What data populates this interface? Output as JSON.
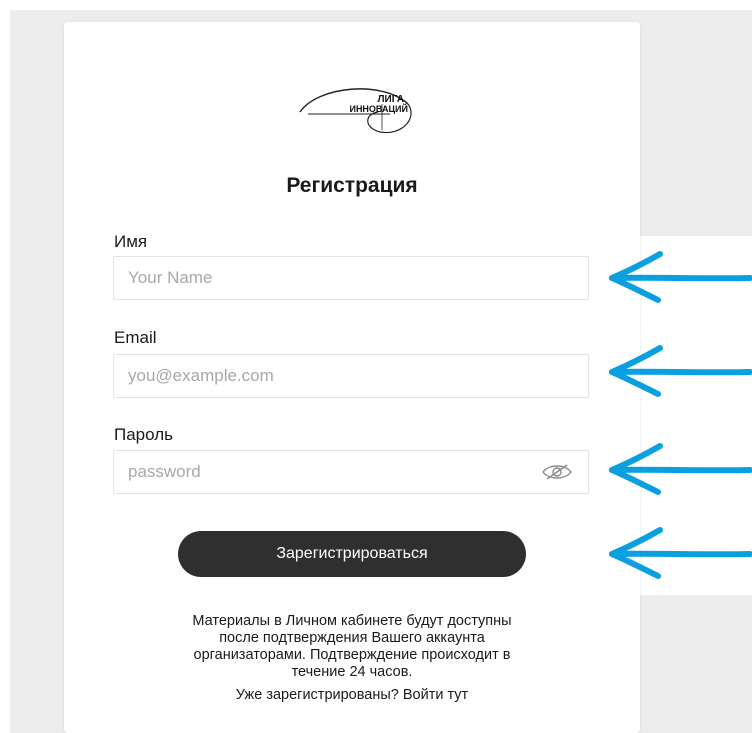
{
  "brand": {
    "logo_line1": "ЛИГА",
    "logo_line2": "ИННОВАЦИЙ"
  },
  "form": {
    "title": "Регистрация",
    "fields": [
      {
        "label": "Имя",
        "placeholder": "Your Name"
      },
      {
        "label": "Email",
        "placeholder": "you@example.com"
      },
      {
        "label": "Пароль",
        "placeholder": "password"
      }
    ],
    "submit_label": "Зарегистрироваться",
    "note_lines": [
      "Материалы в Личном кабинете будут доступны",
      "после подтверждения Вашего аккаунта",
      "организаторами. Подтверждение происходит в",
      "течение 24 часов."
    ],
    "login_prompt": "Уже зарегистрированы?",
    "login_link": "Войти тут"
  },
  "colors": {
    "page_background": "#ececec",
    "card_background": "#ffffff",
    "button_background": "#2f2f2f",
    "annotation_arrow": "#0aa0e0"
  },
  "icons": {
    "password_toggle": "eye-slash-icon",
    "annotation": "arrow-left-icon"
  }
}
